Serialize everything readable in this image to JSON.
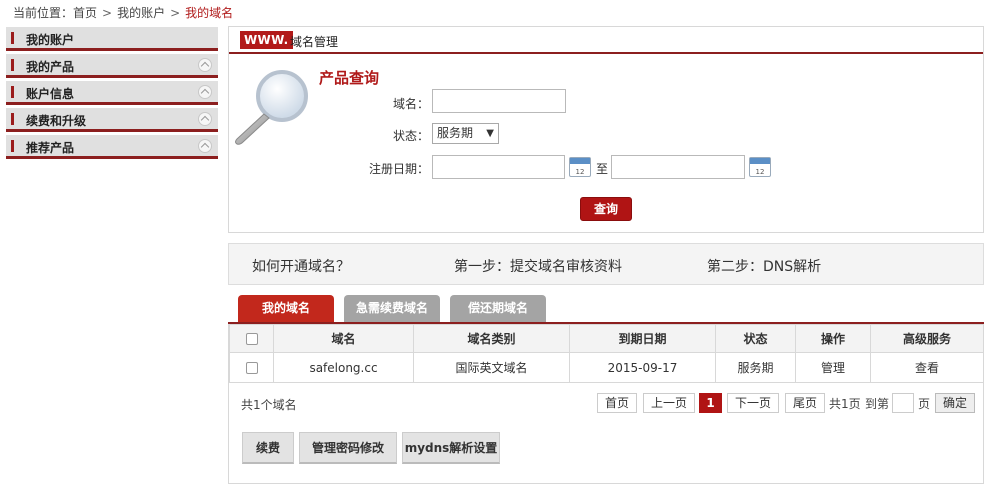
{
  "breadcrumb": {
    "prefix": "当前位置：",
    "items": [
      "首页",
      "我的账户"
    ],
    "current": "我的域名",
    "sep": ">"
  },
  "sidebar": {
    "items": [
      {
        "label": "我的账户"
      },
      {
        "label": "我的产品"
      },
      {
        "label": "账户信息"
      },
      {
        "label": "续费和升级"
      },
      {
        "label": "推荐产品"
      }
    ]
  },
  "panel": {
    "badge": "WWW.",
    "title": "域名管理",
    "query_title": "产品查询",
    "fields": {
      "domain_label": "域名：",
      "domain_value": "",
      "status_label": "状态：",
      "status_value": "服务期",
      "regdate_label": "注册日期：",
      "regdate_from": "",
      "regdate_to": "",
      "to_text": "至",
      "calendar_day": "12"
    },
    "query_button": "查询"
  },
  "howto": {
    "question": "如何开通域名？",
    "step1": "第一步：提交域名审核资料",
    "step2": "第二步：DNS解析"
  },
  "tabs": [
    {
      "label": "我的域名",
      "active": true
    },
    {
      "label": "急需续费域名",
      "active": false
    },
    {
      "label": "偿还期域名",
      "active": false
    }
  ],
  "table": {
    "headers": [
      "",
      "域名",
      "域名类别",
      "到期日期",
      "状态",
      "操作",
      "高级服务"
    ],
    "rows": [
      {
        "domain": "safelong.cc",
        "category": "国际英文域名",
        "expiry": "2015-09-17",
        "status": "服务期",
        "action": "管理",
        "advanced": "查看"
      }
    ]
  },
  "pager": {
    "total": "共1个域名",
    "first": "首页",
    "prev": "上一页",
    "current": "1",
    "next": "下一页",
    "last": "尾页",
    "pages_text": "共1页",
    "goto_text": "到第",
    "page_unit": "页",
    "confirm": "确定"
  },
  "actions": [
    "续费",
    "管理密码修改",
    "mydns解析设置"
  ],
  "colors": {
    "accent": "#b01a1a",
    "border_accent": "#8c1f1f"
  }
}
